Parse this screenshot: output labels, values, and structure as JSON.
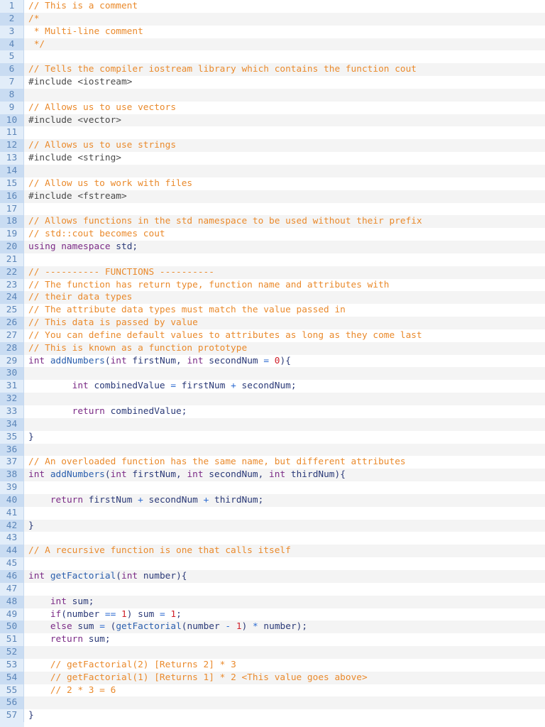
{
  "colors": {
    "comment": "#ea8a2c",
    "keyword": "#7b2b86",
    "function": "#2b5fae",
    "identifier": "#2b3a78",
    "number": "#d0212b",
    "gutter": "#e2edf9"
  },
  "lines": [
    [
      [
        "c",
        "// This is a comment"
      ]
    ],
    [
      [
        "c",
        "/*"
      ]
    ],
    [
      [
        "c",
        " * Multi-line comment"
      ]
    ],
    [
      [
        "c",
        " */"
      ]
    ],
    [],
    [
      [
        "c",
        "// Tells the compiler iostream library which contains the function cout"
      ]
    ],
    [
      [
        "p",
        "#include <iostream>"
      ]
    ],
    [],
    [
      [
        "c",
        "// Allows us to use vectors"
      ]
    ],
    [
      [
        "p",
        "#include <vector>"
      ]
    ],
    [],
    [
      [
        "c",
        "// Allows us to use strings"
      ]
    ],
    [
      [
        "p",
        "#include <string>"
      ]
    ],
    [],
    [
      [
        "c",
        "// Allow us to work with files"
      ]
    ],
    [
      [
        "p",
        "#include <fstream>"
      ]
    ],
    [],
    [
      [
        "c",
        "// Allows functions in the std namespace to be used without their prefix"
      ]
    ],
    [
      [
        "c",
        "// std::cout becomes cout"
      ]
    ],
    [
      [
        "k",
        "using namespace"
      ],
      [
        "i",
        " std;"
      ]
    ],
    [],
    [
      [
        "c",
        "// ---------- FUNCTIONS ----------"
      ]
    ],
    [
      [
        "c",
        "// The function has return type, function name and attributes with"
      ]
    ],
    [
      [
        "c",
        "// their data types"
      ]
    ],
    [
      [
        "c",
        "// The attribute data types must match the value passed in"
      ]
    ],
    [
      [
        "c",
        "// This data is passed by value"
      ]
    ],
    [
      [
        "c",
        "// You can define default values to attributes as long as they come last"
      ]
    ],
    [
      [
        "c",
        "// This is known as a function prototype"
      ]
    ],
    [
      [
        "k",
        "int"
      ],
      [
        "f",
        " addNumbers"
      ],
      [
        "i",
        "("
      ],
      [
        "k",
        "int"
      ],
      [
        "i",
        " firstNum, "
      ],
      [
        "k",
        "int"
      ],
      [
        "i",
        " secondNum "
      ],
      [
        "o",
        "="
      ],
      [
        "i",
        " "
      ],
      [
        "n",
        "0"
      ],
      [
        "i",
        "){"
      ]
    ],
    [],
    [
      [
        "i",
        "        "
      ],
      [
        "k",
        "int"
      ],
      [
        "i",
        " combinedValue "
      ],
      [
        "o",
        "="
      ],
      [
        "i",
        " firstNum "
      ],
      [
        "o",
        "+"
      ],
      [
        "i",
        " secondNum;"
      ]
    ],
    [],
    [
      [
        "i",
        "        "
      ],
      [
        "k",
        "return"
      ],
      [
        "i",
        " combinedValue;"
      ]
    ],
    [],
    [
      [
        "i",
        "}"
      ]
    ],
    [],
    [
      [
        "c",
        "// An overloaded function has the same name, but different attributes"
      ]
    ],
    [
      [
        "k",
        "int"
      ],
      [
        "f",
        " addNumbers"
      ],
      [
        "i",
        "("
      ],
      [
        "k",
        "int"
      ],
      [
        "i",
        " firstNum, "
      ],
      [
        "k",
        "int"
      ],
      [
        "i",
        " secondNum, "
      ],
      [
        "k",
        "int"
      ],
      [
        "i",
        " thirdNum){"
      ]
    ],
    [],
    [
      [
        "i",
        "    "
      ],
      [
        "k",
        "return"
      ],
      [
        "i",
        " firstNum "
      ],
      [
        "o",
        "+"
      ],
      [
        "i",
        " secondNum "
      ],
      [
        "o",
        "+"
      ],
      [
        "i",
        " thirdNum;"
      ]
    ],
    [],
    [
      [
        "i",
        "}"
      ]
    ],
    [],
    [
      [
        "c",
        "// A recursive function is one that calls itself"
      ]
    ],
    [],
    [
      [
        "k",
        "int"
      ],
      [
        "f",
        " getFactorial"
      ],
      [
        "i",
        "("
      ],
      [
        "k",
        "int"
      ],
      [
        "i",
        " number){"
      ]
    ],
    [],
    [
      [
        "i",
        "    "
      ],
      [
        "k",
        "int"
      ],
      [
        "i",
        " sum;"
      ]
    ],
    [
      [
        "i",
        "    "
      ],
      [
        "k",
        "if"
      ],
      [
        "i",
        "(number "
      ],
      [
        "o",
        "=="
      ],
      [
        "i",
        " "
      ],
      [
        "n",
        "1"
      ],
      [
        "i",
        ") sum "
      ],
      [
        "o",
        "="
      ],
      [
        "i",
        " "
      ],
      [
        "n",
        "1"
      ],
      [
        "i",
        ";"
      ]
    ],
    [
      [
        "i",
        "    "
      ],
      [
        "k",
        "else"
      ],
      [
        "i",
        " sum "
      ],
      [
        "o",
        "="
      ],
      [
        "i",
        " ("
      ],
      [
        "f",
        "getFactorial"
      ],
      [
        "i",
        "(number "
      ],
      [
        "o",
        "-"
      ],
      [
        "i",
        " "
      ],
      [
        "n",
        "1"
      ],
      [
        "i",
        ") "
      ],
      [
        "o",
        "*"
      ],
      [
        "i",
        " number);"
      ]
    ],
    [
      [
        "i",
        "    "
      ],
      [
        "k",
        "return"
      ],
      [
        "i",
        " sum;"
      ]
    ],
    [],
    [
      [
        "i",
        "    "
      ],
      [
        "c",
        "// getFactorial(2) [Returns 2] * 3"
      ]
    ],
    [
      [
        "i",
        "    "
      ],
      [
        "c",
        "// getFactorial(1) [Returns 1] * 2 <This value goes above>"
      ]
    ],
    [
      [
        "i",
        "    "
      ],
      [
        "c",
        "// 2 * 3 = 6"
      ]
    ],
    [],
    [
      [
        "i",
        "}"
      ]
    ]
  ]
}
